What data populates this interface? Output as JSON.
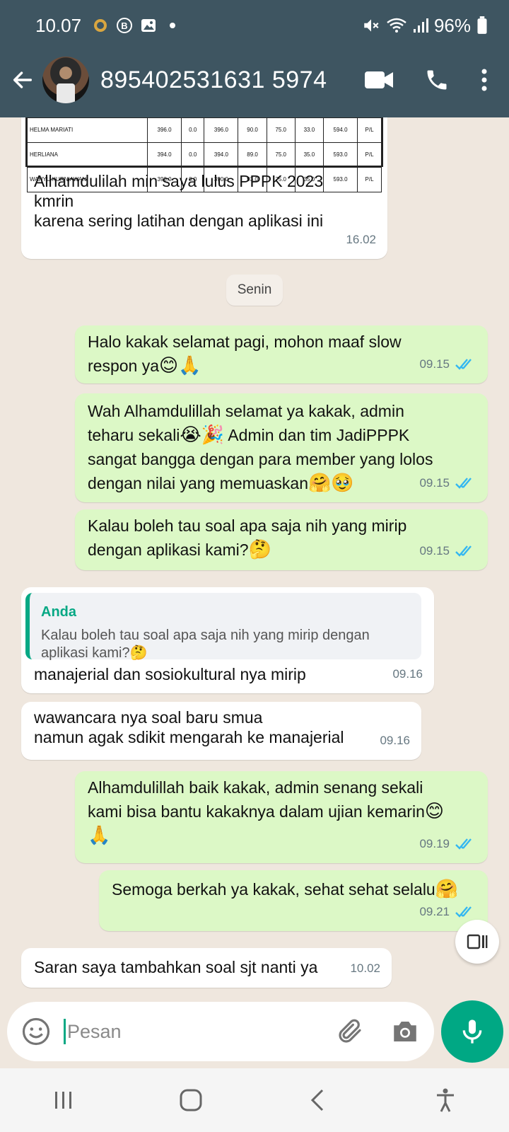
{
  "status_bar": {
    "time": "10.07",
    "battery": "96%"
  },
  "header": {
    "contact": "895402531631 5974"
  },
  "shared_table": {
    "rows": [
      [
        "HELMA MARIATI",
        "396.0",
        "0.0",
        "396.0",
        "90.0",
        "75.0",
        "33.0",
        "594.0",
        "P/L"
      ],
      [
        "HERLIANA",
        "394.0",
        "0.0",
        "394.0",
        "89.0",
        "75.0",
        "35.0",
        "593.0",
        "P/L"
      ],
      [
        "WAHYU KURNIAWAN",
        "390.0",
        "0.0",
        "390.0",
        "93.0",
        "75.0",
        "35.0",
        "593.0",
        "P/L"
      ]
    ]
  },
  "messages": [
    {
      "text": "Alhamdulilah min saya lulus PPPK 2023\nkmrin\nkarena sering latihan dengan aplikasi ini",
      "time": "16.02"
    },
    {
      "text": "Senin"
    },
    {
      "text": "Halo kakak selamat pagi, mohon maaf slow\nrespon ya",
      "emoji": "😊🙏",
      "time": "09.15"
    },
    {
      "text": "Wah Alhamdulillah selamat ya kakak, admin\nteharu sekali",
      "emoji1": "😭🎉",
      "text2": " Admin dan tim JadiPPPK\nsangat bangga dengan para member yang lolos\ndengan nilai yang memuaskan",
      "emoji2": "🤗🥹",
      "time": "09.15"
    },
    {
      "text": "Kalau boleh tau soal apa saja nih yang mirip\ndengan aplikasi kami?",
      "emoji": "🤔",
      "time": "09.15"
    },
    {
      "quote_author": "Anda",
      "quote_text": "Kalau boleh tau soal apa saja nih yang mirip dengan\naplikasi kami?🤔",
      "text": "manajerial dan sosiokultural nya mirip",
      "time": "09.16"
    },
    {
      "text": "wawancara nya soal baru smua\nnamun agak sdikit mengarah ke manajerial",
      "time": "09.16"
    },
    {
      "text": "Alhamdulillah baik kakak, admin senang sekali\nkami bisa bantu kakaknya dalam ujian kemarin",
      "emoji": "😊",
      "emoji_line": "🙏",
      "time": "09.19"
    },
    {
      "text": "Semoga berkah ya kakak, sehat sehat selalu",
      "emoji": "🤗",
      "time": "09.21"
    },
    {
      "text": "Saran saya tambahkan soal sjt nanti ya",
      "time": "10.02"
    }
  ],
  "input": {
    "placeholder": "Pesan"
  },
  "colors": {
    "header": "#3e5561",
    "outgoing": "#dcf8c6",
    "accent": "#00a884",
    "read_ticks": "#34b7f1"
  }
}
